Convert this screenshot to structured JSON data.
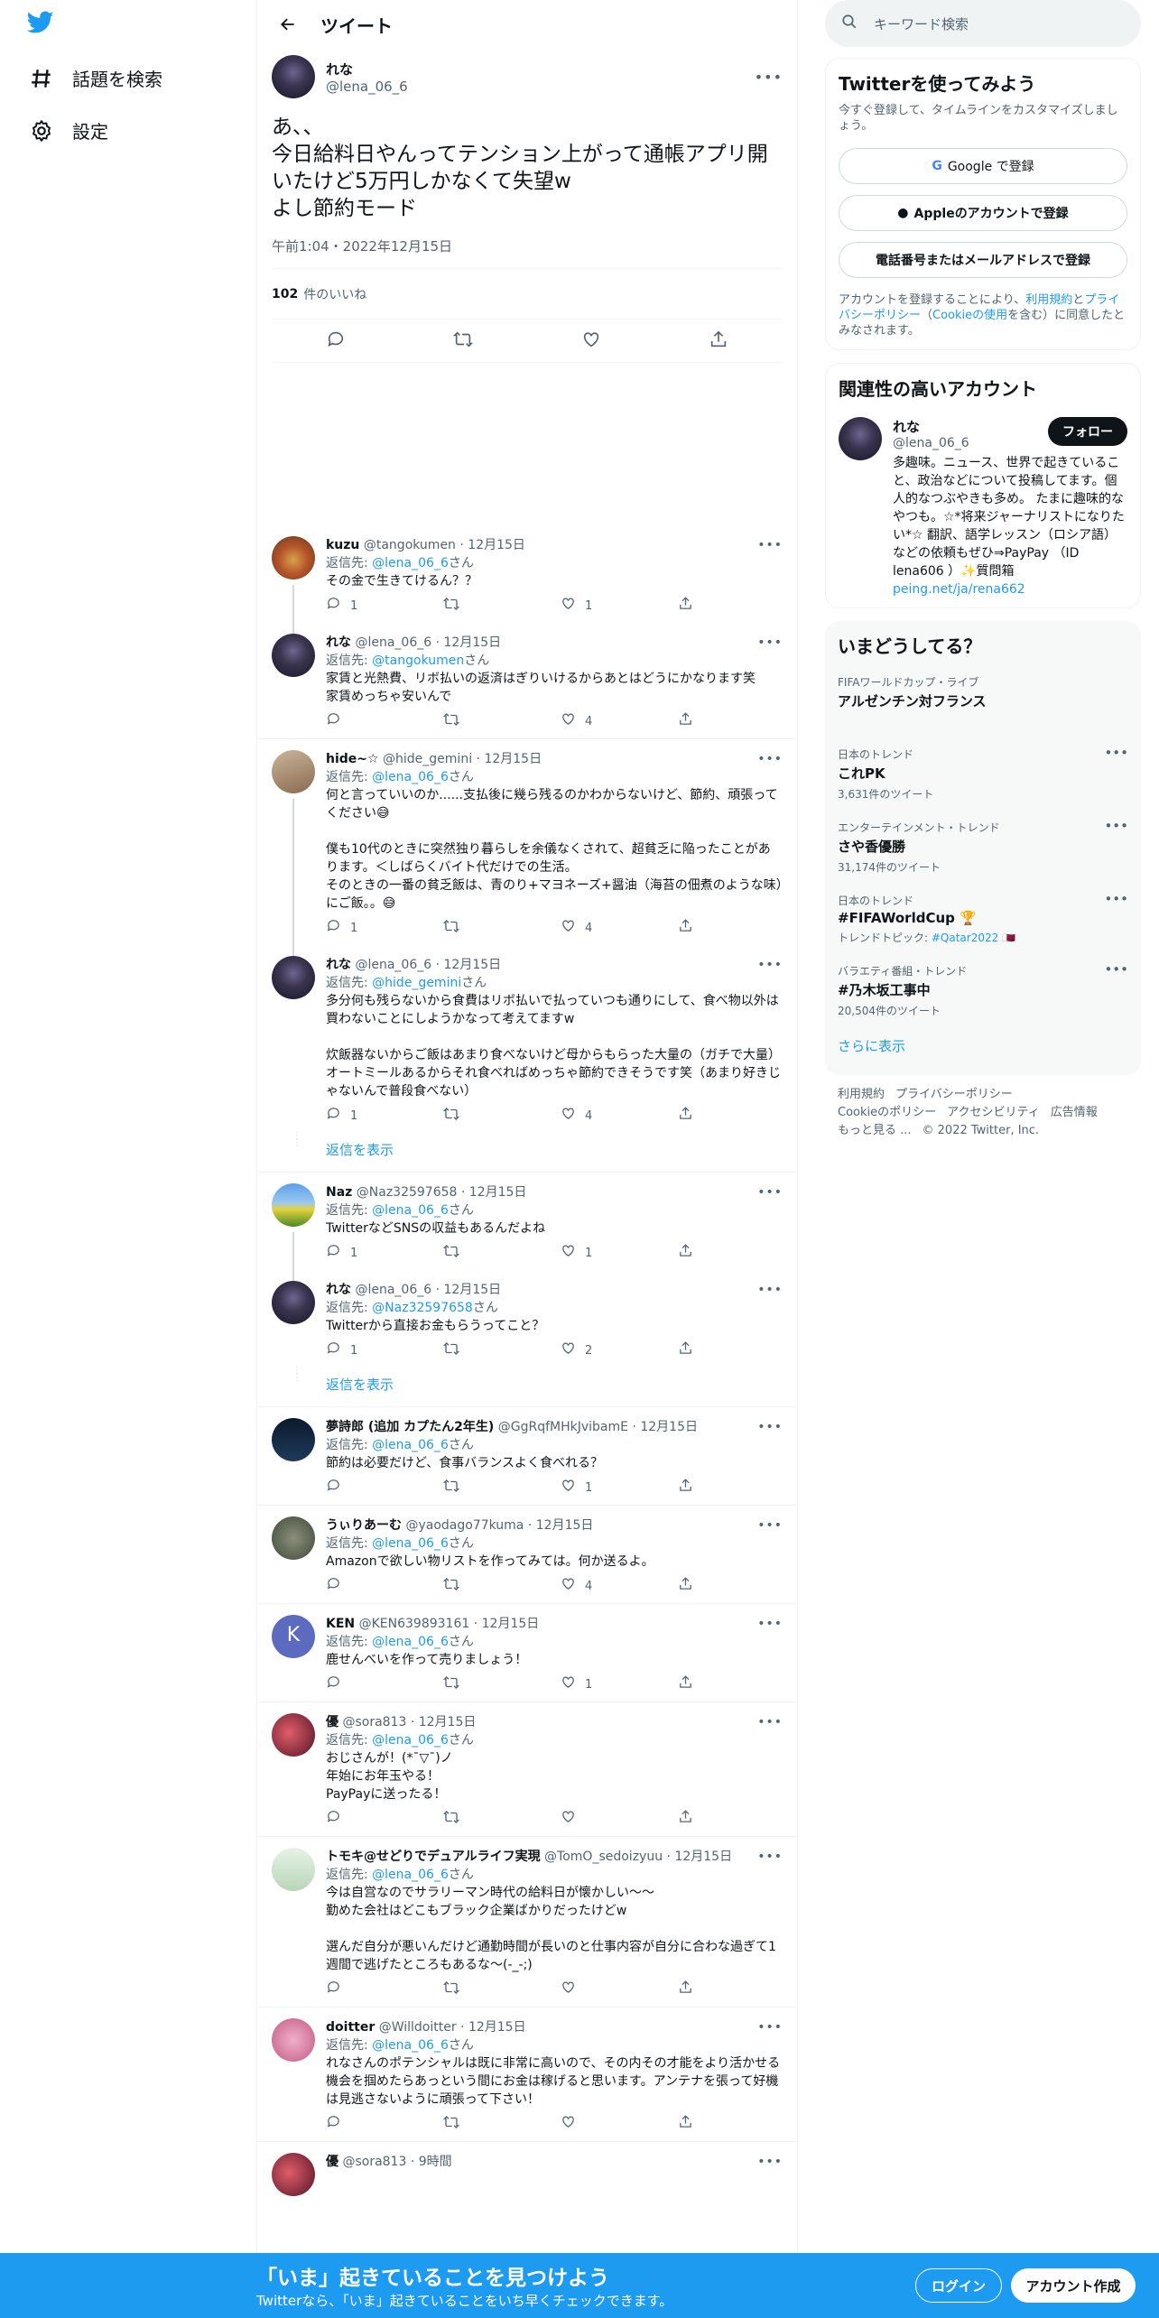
{
  "nav": {
    "explore": "話題を検索",
    "settings": "設定"
  },
  "header": {
    "title": "ツイート"
  },
  "tweet": {
    "name": "れな",
    "handle": "@lena_06_6",
    "text": "あ、、\n今日給料日やんってテンション上がって通帳アプリ開いたけど5万円しかなくて失望w\nよし節約モード",
    "date": "午前1:04・2022年12月15日",
    "likes_count": "102",
    "likes_label": "件のいいね"
  },
  "replies": [
    {
      "name": "kuzu",
      "handle": "@tangokumen",
      "date": "12月15日",
      "reply_label": "返信先:",
      "reply_to": "@lena_06_6",
      "reply_suffix": "さん",
      "text": "その金で生きてけるん？？",
      "replies": "1",
      "retweets": "",
      "likes": "1",
      "thread": true,
      "avatar": "food"
    },
    {
      "name": "れな",
      "handle": "@lena_06_6",
      "date": "12月15日",
      "reply_label": "返信先:",
      "reply_to": "@tangokumen",
      "reply_suffix": "さん",
      "text": "家賃と光熱費、リボ払いの返済はぎりいけるからあとはどうにかなります笑\n家賃めっちゃ安いんで",
      "replies": "",
      "retweets": "",
      "likes": "4",
      "thread": false,
      "avatar": "dark",
      "sep": true
    },
    {
      "name": "hide~☆",
      "handle": "@hide_gemini",
      "date": "12月15日",
      "reply_label": "返信先:",
      "reply_to": "@lena_06_6",
      "reply_suffix": "さん",
      "text": "何と言っていいのか......支払後に幾ら残るのかわからないけど、節約、頑張ってください😅\n\n僕も10代のときに突然独り暮らしを余儀なくされて、超貧乏に陥ったことがあります。＜しばらくバイト代だけでの生活。\nそのときの一番の貧乏飯は、青のり+マヨネーズ+醤油（海苔の佃煮のような味）にご飯。。😅",
      "replies": "1",
      "retweets": "",
      "likes": "4",
      "thread": true,
      "avatar": "anime"
    },
    {
      "name": "れな",
      "handle": "@lena_06_6",
      "date": "12月15日",
      "reply_label": "返信先:",
      "reply_to": "@hide_gemini",
      "reply_suffix": "さん",
      "text": "多分何も残らないから食費はリボ払いで払っていつも通りにして、食べ物以外は買わないことにしようかなって考えてますw\n\n炊飯器ないからご飯はあまり食べないけど母からもらった大量の（ガチで大量）オートミールあるからそれ食べればめっちゃ節約できそうです笑（あまり好きじゃないんで普段食べない）",
      "replies": "1",
      "retweets": "",
      "likes": "4",
      "thread": false,
      "avatar": "dark",
      "showmore": "返信を表示"
    },
    {
      "name": "Naz",
      "handle": "@Naz32597658",
      "date": "12月15日",
      "reply_label": "返信先:",
      "reply_to": "@lena_06_6",
      "reply_suffix": "さん",
      "text": "TwitterなどSNSの収益もあるんだよね",
      "replies": "1",
      "retweets": "",
      "likes": "1",
      "thread": true,
      "avatar": "field"
    },
    {
      "name": "れな",
      "handle": "@lena_06_6",
      "date": "12月15日",
      "reply_label": "返信先:",
      "reply_to": "@Naz32597658",
      "reply_suffix": "さん",
      "text": "Twitterから直接お金もらうってこと？",
      "replies": "1",
      "retweets": "",
      "likes": "2",
      "thread": false,
      "avatar": "dark",
      "showmore": "返信を表示"
    },
    {
      "name": "夢詩郎 (追加 カプたん2年生)",
      "handle": "@GgRqfMHkJvibamE",
      "date": "12月15日",
      "reply_label": "返信先:",
      "reply_to": "@lena_06_6",
      "reply_suffix": "さん",
      "text": "節約は必要だけど、食事バランスよく食べれる？",
      "replies": "",
      "retweets": "",
      "likes": "1",
      "thread": false,
      "avatar": "tower",
      "sep": true
    },
    {
      "name": "うぃりあーむ",
      "handle": "@yaodago77kuma",
      "date": "12月15日",
      "reply_label": "返信先:",
      "reply_to": "@lena_06_6",
      "reply_suffix": "さん",
      "text": "Amazonで欲しい物リストを作ってみては。何か送るよ。",
      "replies": "",
      "retweets": "",
      "likes": "4",
      "thread": false,
      "avatar": "fox",
      "sep": true
    },
    {
      "name": "KEN",
      "handle": "@KEN639893161",
      "date": "12月15日",
      "reply_label": "返信先:",
      "reply_to": "@lena_06_6",
      "reply_suffix": "さん",
      "text": "鹿せんべいを作って売りましょう！",
      "replies": "",
      "retweets": "",
      "likes": "1",
      "thread": false,
      "avatar": "letter",
      "avatar_letter": "K",
      "sep": true
    },
    {
      "name": "優",
      "handle": "@sora813",
      "date": "12月15日",
      "reply_label": "返信先:",
      "reply_to": "@lena_06_6",
      "reply_suffix": "さん",
      "text": "おじさんが！(*¯▽¯)ノ\n年始にお年玉やる！\nPayPayに送ったる！",
      "replies": "",
      "retweets": "",
      "likes": "",
      "thread": false,
      "avatar": "flower",
      "sep": true
    },
    {
      "name": "トモキ@せどりでデュアルライフ実現",
      "handle": "@TomO_sedoizyuu",
      "date": "12月15日",
      "reply_label": "返信先:",
      "reply_to": "@lena_06_6",
      "reply_suffix": "さん",
      "text": "今は自営なのでサラリーマン時代の給料日が懐かしい～～\n勤めた会社はどこもブラック企業ばかりだったけどw\n\n選んだ自分が悪いんだけど通勤時間が長いのと仕事内容が自分に合わな過ぎて1週間で逃げたところもあるな～(-_-;)",
      "replies": "",
      "retweets": "",
      "likes": "",
      "thread": false,
      "avatar": "person",
      "sep": true
    },
    {
      "name": "doitter",
      "handle": "@Willdoitter",
      "date": "12月15日",
      "reply_label": "返信先:",
      "reply_to": "@lena_06_6",
      "reply_suffix": "さん",
      "text": "れなさんのポテンシャルは既に非常に高いので、その内その才能をより活かせる機会を掴めたらあっという間にお金は稼げると思います。アンテナを張って好機は見逃さないように頑張って下さい！",
      "replies": "",
      "retweets": "",
      "likes": "",
      "thread": false,
      "avatar": "pink",
      "sep": true
    },
    {
      "name": "優",
      "handle": "@sora813",
      "date": "9時間",
      "reply_label": "",
      "reply_to": "",
      "reply_suffix": "",
      "text": "",
      "replies": "",
      "retweets": "",
      "likes": "",
      "thread": false,
      "avatar": "flower",
      "partial": true
    }
  ],
  "search": {
    "placeholder": "キーワード検索"
  },
  "signup": {
    "title": "Twitterを使ってみよう",
    "subtitle": "今すぐ登録して、タイムラインをカスタマイズしましょう。",
    "google": "Google で登録",
    "apple": "Appleのアカウントで登録",
    "phone": "電話番号またはメールアドレスで登録",
    "terms_pre": "アカウントを登録することにより、",
    "terms_link": "利用規約",
    "terms_and": "と",
    "privacy_link": "プライバシーポリシー",
    "cookie_open": "（",
    "cookie_link": "Cookieの使用",
    "cookie_post": "を含む）に同意したとみなされます。"
  },
  "related": {
    "title": "関連性の高いアカウント",
    "name": "れな",
    "handle": "@lena_06_6",
    "follow": "フォロー",
    "bio": "多趣味。ニュース、世界で起きていること、政治などについて投稿してます。個人的なつぶやきも多め。 たまに趣味的なやつも。☆*将来ジャーナリストになりたい*☆ 翻訳、語学レッスン（ロシア語）などの依頼もぜひ⇒PayPay （ID lena606 ）✨質問箱",
    "link": "peing.net/ja/rena662"
  },
  "trends": {
    "title": "いまどうしてる？",
    "items": [
      {
        "cat": "FIFAワールドカップ・ライブ",
        "title": "アルゼンチン対フランス",
        "count": "",
        "topic": "",
        "topic_label": ""
      },
      {
        "cat": "日本のトレンド",
        "title": "これPK",
        "count": "3,631件のツイート",
        "topic": "",
        "topic_label": ""
      },
      {
        "cat": "エンターテインメント・トレンド",
        "title": "さや香優勝",
        "count": "31,174件のツイート",
        "topic": "",
        "topic_label": ""
      },
      {
        "cat": "日本のトレンド",
        "title": "#FIFAWorldCup 🏆",
        "count": "",
        "topic": "#Qatar2022 🇶🇦",
        "topic_label": "トレンドトピック: "
      },
      {
        "cat": "バラエティ番組・トレンド",
        "title": "#乃木坂工事中",
        "count": "20,504件のツイート",
        "topic": "",
        "topic_label": ""
      }
    ],
    "show_more": "さらに表示"
  },
  "footer": {
    "terms": "利用規約",
    "privacy": "プライバシーポリシー",
    "cookie": "Cookieのポリシー",
    "accessibility": "アクセシビリティ",
    "ads": "広告情報",
    "more": "もっと見る ...",
    "copyright": "© 2022 Twitter, Inc."
  },
  "bottom_bar": {
    "title": "「いま」起きていることを見つけよう",
    "subtitle": "Twitterなら、「いま」起きていることをいち早くチェックできます。",
    "login": "ログイン",
    "signup": "アカウント作成"
  },
  "colors": {
    "accent": "#1d9bf0",
    "text": "#0f1419",
    "muted": "#536471",
    "border": "#eff3f4"
  }
}
